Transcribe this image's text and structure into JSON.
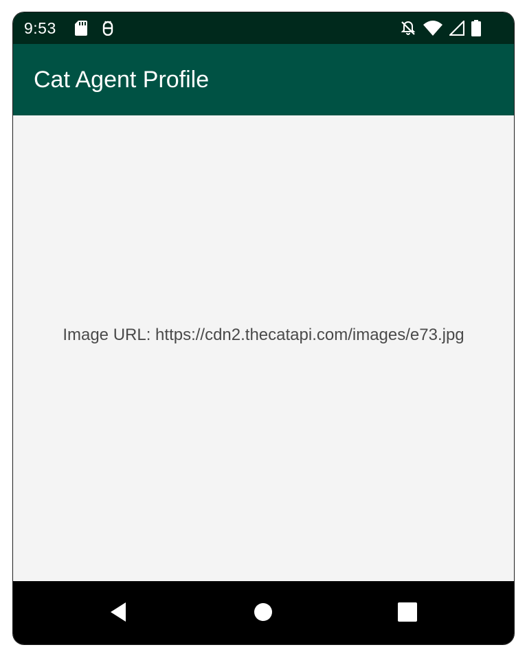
{
  "status_bar": {
    "time": "9:53",
    "left_icons": [
      "sd-card-icon",
      "android-debug-icon"
    ],
    "right_icons": [
      "notifications-off-icon",
      "wifi-icon",
      "cell-signal-icon",
      "battery-icon"
    ]
  },
  "app_bar": {
    "title": "Cat Agent Profile",
    "color": "#005244"
  },
  "content": {
    "image_url_text": "Image URL: https://cdn2.thecatapi.com/images/e73.jpg"
  },
  "nav_bar": {
    "buttons": [
      "back-icon",
      "home-icon",
      "recents-icon"
    ]
  },
  "colors": {
    "status_bar": "#00291c",
    "app_bar": "#005244",
    "background": "#f4f4f4",
    "nav_bar": "#000000"
  }
}
